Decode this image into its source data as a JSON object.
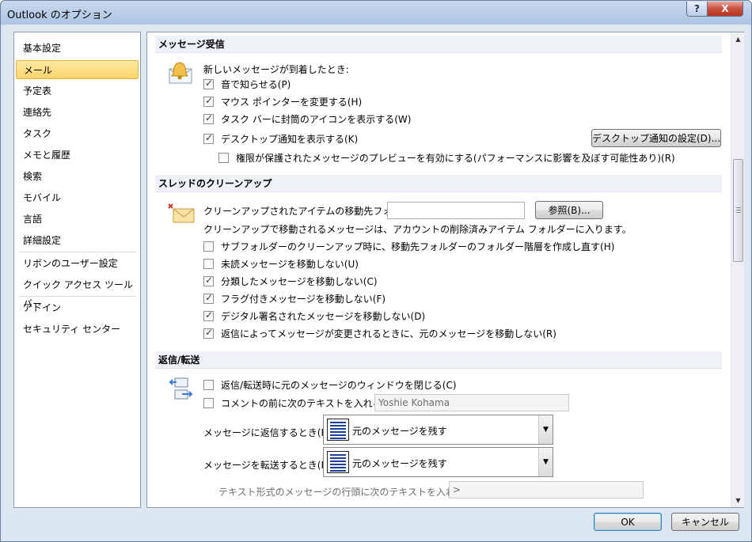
{
  "window": {
    "title": "Outlook のオプション",
    "help_label": "?",
    "close_label": "X"
  },
  "sidebar": {
    "items": [
      {
        "label": "基本設定"
      },
      {
        "label": "メール"
      },
      {
        "label": "予定表"
      },
      {
        "label": "連絡先"
      },
      {
        "label": "タスク"
      },
      {
        "label": "メモと履歴"
      },
      {
        "label": "検索"
      },
      {
        "label": "モバイル"
      },
      {
        "label": "言語"
      },
      {
        "label": "詳細設定"
      },
      {
        "label": "リボンのユーザー設定"
      },
      {
        "label": "クイック アクセス ツール バー"
      },
      {
        "label": "アドイン"
      },
      {
        "label": "セキュリティ センター"
      }
    ],
    "selected_index": 1
  },
  "message_arrival": {
    "header": "メッセージ受信",
    "intro": "新しいメッセージが到着したとき:",
    "play_sound": {
      "label": "音で知らせる(P)",
      "checked": true
    },
    "change_pointer": {
      "label": "マウス ポインターを変更する(H)",
      "checked": true
    },
    "taskbar_icon": {
      "label": "タスク バーに封筒のアイコンを表示する(W)",
      "checked": true
    },
    "desktop_alert": {
      "label": "デスクトップ通知を表示する(K)",
      "checked": true
    },
    "desktop_alert_settings_button": "デスクトップ通知の設定(D)...",
    "rights_preview": {
      "label": "権限が保護されたメッセージのプレビューを有効にする(パフォーマンスに影響を及ぼす可能性あり)(R)",
      "checked": false
    }
  },
  "conversation_cleanup": {
    "header": "スレッドのクリーンアップ",
    "folder_label": "クリーンアップされたアイテムの移動先フォルダー:",
    "folder_value": "",
    "browse_button": "参照(B)...",
    "info": "クリーンアップで移動されるメッセージは、アカウントの削除済みアイテム フォルダーに入ります。",
    "options": [
      {
        "label": "サブフォルダーのクリーンアップ時に、移動先フォルダーのフォルダー階層を作成し直す(H)",
        "checked": false
      },
      {
        "label": "未読メッセージを移動しない(U)",
        "checked": false
      },
      {
        "label": "分類したメッセージを移動しない(C)",
        "checked": true
      },
      {
        "label": "フラグ付きメッセージを移動しない(F)",
        "checked": true
      },
      {
        "label": "デジタル署名されたメッセージを移動しない(D)",
        "checked": true
      },
      {
        "label": "返信によってメッセージが変更されるときに、元のメッセージを移動しない(R)",
        "checked": true
      }
    ]
  },
  "replies_forwards": {
    "header": "返信/転送",
    "close_original": {
      "label": "返信/転送時に元のメッセージのウィンドウを閉じる(C)",
      "checked": false
    },
    "preface_comments": {
      "label": "コメントの前に次のテキストを入れる(A):",
      "checked": false
    },
    "preface_value": "Yoshie Kohama",
    "reply_label": "メッセージに返信するとき(R):",
    "reply_value": "元のメッセージを残す",
    "forward_label": "メッセージを転送するとき(F):",
    "forward_value": "元のメッセージを残す",
    "prefix_label": "テキスト形式のメッセージの行頭に次のテキストを入れる(P):",
    "prefix_value": ">"
  },
  "footer": {
    "ok": "OK",
    "cancel": "キャンセル"
  }
}
